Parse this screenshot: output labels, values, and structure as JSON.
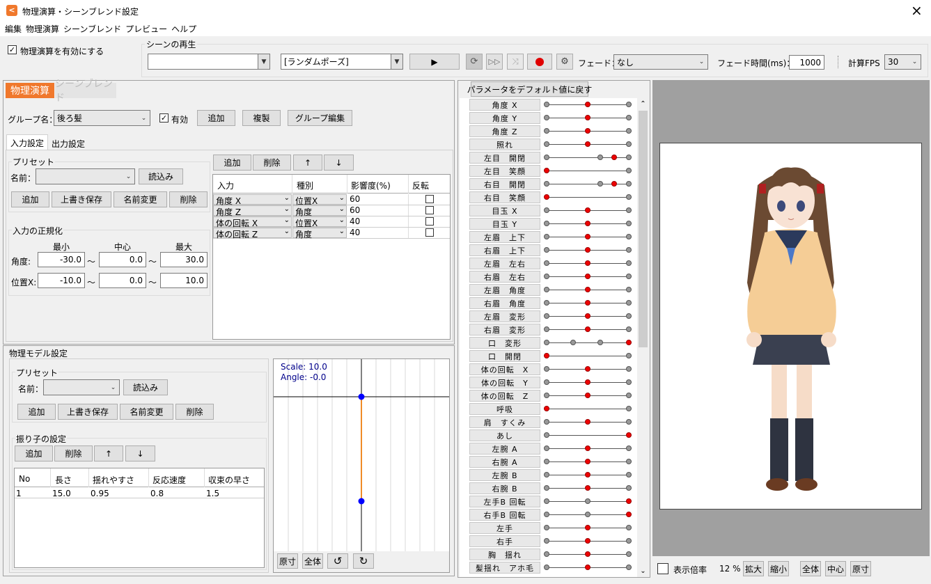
{
  "title": "物理演算・シーンブレンド設定",
  "close_icon": "×",
  "menu": [
    "編集",
    "物理演算",
    "シーンブレンド",
    "プレビュー",
    "ヘルプ"
  ],
  "toolbar": {
    "physics_enable_label": "物理演算を有効にする",
    "physics_enabled": true,
    "scene_play_label": "シーンの再生",
    "scene_combo_value": "",
    "pose_combo_value": "[ランダムポーズ]",
    "fade_label": "フェード：",
    "fade_value": "なし",
    "fade_time_label": "フェード時間(ms)：",
    "fade_time_value": "1000",
    "fps_label": "計算FPS",
    "fps_value": "30"
  },
  "tabs": {
    "physics": "物理演算",
    "scene_blend": "シーンブレンド"
  },
  "group": {
    "name_label": "グループ名：",
    "name_value": "後ろ髪",
    "enabled_label": "有効",
    "add": "追加",
    "duplicate": "複製",
    "edit": "グループ編集"
  },
  "subtabs": {
    "input": "入力設定",
    "output": "出力設定"
  },
  "input_preset": {
    "title": "プリセット",
    "name_label": "名前：",
    "load": "読込み",
    "add": "追加",
    "overwrite": "上書き保存",
    "rename": "名前変更",
    "delete": "削除"
  },
  "normalize": {
    "title": "入力の正規化",
    "headers": [
      "最小",
      "中心",
      "最大"
    ],
    "rows": [
      {
        "label": "角度:",
        "min": "-30.0",
        "center": "0.0",
        "max": "30.0"
      },
      {
        "label": "位置X:",
        "min": "-10.0",
        "center": "0.0",
        "max": "10.0"
      }
    ],
    "tilde": "〜"
  },
  "input_table": {
    "buttons": {
      "add": "追加",
      "delete": "削除",
      "up": "↑",
      "down": "↓"
    },
    "headers": [
      "入力",
      "種別",
      "影響度(%)",
      "反転"
    ],
    "rows": [
      {
        "input": "角度 X",
        "type": "位置X",
        "weight": "60"
      },
      {
        "input": "角度 Z",
        "type": "角度",
        "weight": "60"
      },
      {
        "input": "体の回転 X",
        "type": "位置X",
        "weight": "40"
      },
      {
        "input": "体の回転 Z",
        "type": "角度",
        "weight": "40"
      }
    ]
  },
  "model": {
    "title": "物理モデル設定",
    "preset_title": "プリセット",
    "name_label": "名前：",
    "load": "読込み",
    "add": "追加",
    "overwrite": "上書き保存",
    "rename": "名前変更",
    "delete": "削除",
    "pendulum_title": "振り子の設定",
    "pend_buttons": {
      "add": "追加",
      "delete": "削除",
      "up": "↑",
      "down": "↓"
    },
    "headers": [
      "No",
      "長さ",
      "揺れやすさ",
      "反応速度",
      "収束の早さ"
    ],
    "rows": [
      {
        "no": "1",
        "length": "15.0",
        "sway": "0.95",
        "react": "0.8",
        "conv": "1.5"
      }
    ]
  },
  "preview_graph": {
    "scale": "Scale: 10.0",
    "angle": "Angle: -0.0",
    "buttons": {
      "reset": "原寸",
      "all": "全体"
    },
    "rotate_left_icon": "↺",
    "rotate_right_icon": "↻"
  },
  "params": {
    "reset_label": "パラメータをデフォルト値に戻す",
    "items": [
      {
        "name": "角度 X",
        "dots": [
          "g",
          "r",
          "g"
        ]
      },
      {
        "name": "角度 Y",
        "dots": [
          "g",
          "r",
          "g"
        ]
      },
      {
        "name": "角度 Z",
        "dots": [
          "g",
          "r",
          "g"
        ]
      },
      {
        "name": "照れ",
        "dots": [
          "g",
          "r",
          "g"
        ]
      },
      {
        "name": "左目　開閉",
        "dots": [
          "g",
          "g",
          "r",
          "g"
        ]
      },
      {
        "name": "左目　笑顔",
        "dots": [
          "r",
          "g"
        ]
      },
      {
        "name": "右目　開閉",
        "dots": [
          "g",
          "g",
          "r",
          "g"
        ]
      },
      {
        "name": "右目　笑顔",
        "dots": [
          "r",
          "g"
        ]
      },
      {
        "name": "目玉 X",
        "dots": [
          "g",
          "r",
          "g"
        ]
      },
      {
        "name": "目玉 Y",
        "dots": [
          "g",
          "r",
          "g"
        ]
      },
      {
        "name": "左眉　上下",
        "dots": [
          "g",
          "r",
          "g"
        ]
      },
      {
        "name": "右眉　上下",
        "dots": [
          "g",
          "r",
          "g"
        ]
      },
      {
        "name": "左眉　左右",
        "dots": [
          "g",
          "r",
          "g"
        ]
      },
      {
        "name": "右眉　左右",
        "dots": [
          "g",
          "r",
          "g"
        ]
      },
      {
        "name": "左眉　角度",
        "dots": [
          "g",
          "r",
          "g"
        ]
      },
      {
        "name": "右眉　角度",
        "dots": [
          "g",
          "r",
          "g"
        ]
      },
      {
        "name": "左眉　変形",
        "dots": [
          "g",
          "r",
          "g"
        ]
      },
      {
        "name": "右眉　変形",
        "dots": [
          "g",
          "r",
          "g"
        ]
      },
      {
        "name": "口　変形",
        "dots": [
          "g",
          "g",
          "g",
          "r"
        ]
      },
      {
        "name": "口　開閉",
        "dots": [
          "r",
          "g"
        ]
      },
      {
        "name": "体の回転　X",
        "dots": [
          "g",
          "r",
          "g"
        ]
      },
      {
        "name": "体の回転　Y",
        "dots": [
          "g",
          "r",
          "g"
        ]
      },
      {
        "name": "体の回転　Z",
        "dots": [
          "g",
          "r",
          "g"
        ]
      },
      {
        "name": "呼吸",
        "dots": [
          "r",
          "g"
        ]
      },
      {
        "name": "肩　すくみ",
        "dots": [
          "g",
          "r",
          "g"
        ]
      },
      {
        "name": "あし",
        "dots": [
          "g",
          "r"
        ]
      },
      {
        "name": "左腕 A",
        "dots": [
          "g",
          "r",
          "g"
        ]
      },
      {
        "name": "右腕 A",
        "dots": [
          "g",
          "r",
          "g"
        ]
      },
      {
        "name": "左腕 B",
        "dots": [
          "g",
          "r",
          "g"
        ]
      },
      {
        "name": "右腕 B",
        "dots": [
          "g",
          "r",
          "g"
        ]
      },
      {
        "name": "左手B 回転",
        "dots": [
          "g",
          "g",
          "r"
        ]
      },
      {
        "name": "右手B 回転",
        "dots": [
          "g",
          "g",
          "r"
        ]
      },
      {
        "name": "左手",
        "dots": [
          "g",
          "r",
          "g"
        ]
      },
      {
        "name": "右手",
        "dots": [
          "g",
          "r",
          "g"
        ]
      },
      {
        "name": "胸　揺れ",
        "dots": [
          "g",
          "r",
          "g"
        ]
      },
      {
        "name": "髪揺れ　アホ毛",
        "dots": [
          "g",
          "r",
          "g"
        ]
      }
    ]
  },
  "viewer": {
    "zoom_label": "表示倍率",
    "zoom_value": "12 %",
    "zoom_in": "拡大",
    "zoom_out": "縮小",
    "fit": "全体",
    "center": "中心",
    "reset": "原寸"
  },
  "colors": {
    "accent_tab": "#f0782c",
    "record": "#e00000",
    "graph_line": "#f08c28",
    "graph_node": "#0000ff"
  }
}
